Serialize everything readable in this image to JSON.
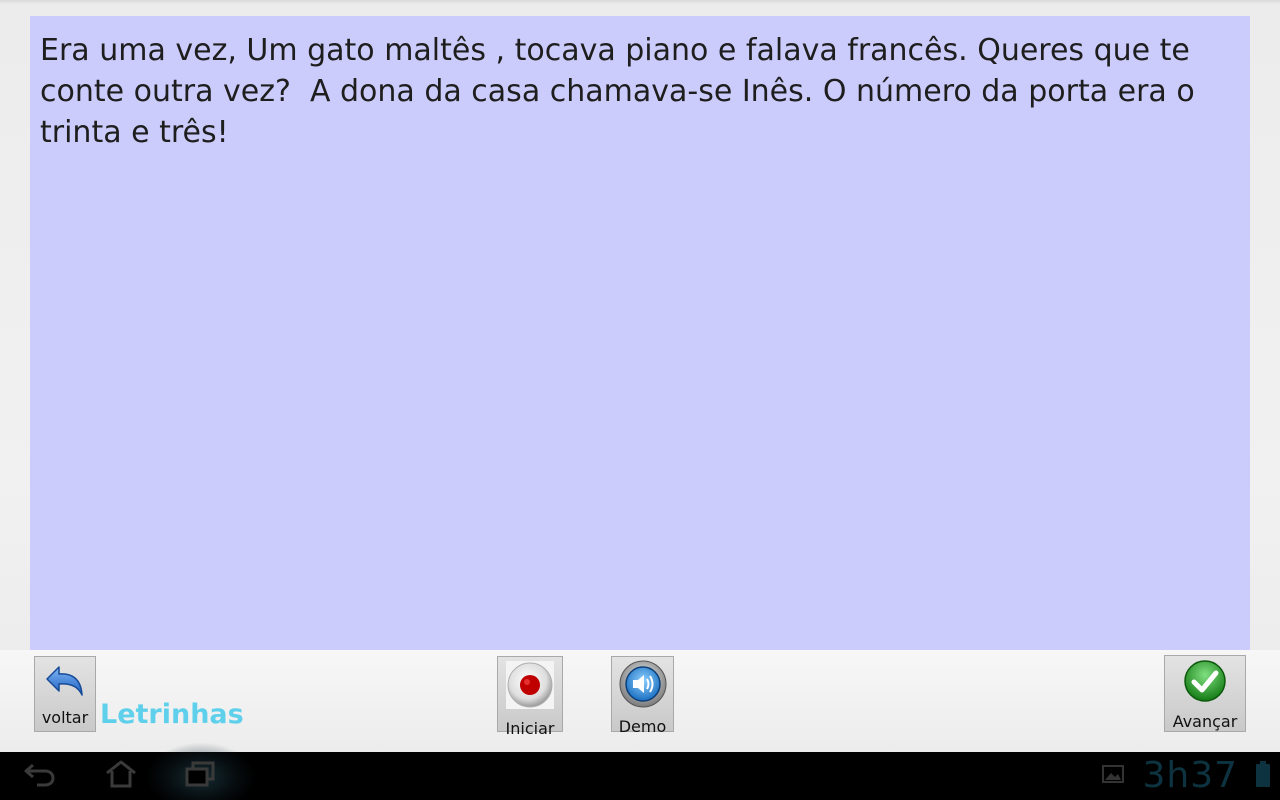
{
  "story": {
    "text": "Era uma vez, Um gato maltês , tocava piano e falava francês. Queres que te conte outra vez?  A dona da casa chamava-se Inês. O número da porta era o trinta e três!"
  },
  "toolbar": {
    "back_label": "voltar",
    "app_name": "Letrinhas",
    "start_label": "Iniciar",
    "demo_label": "Demo",
    "next_label": "Avançar"
  },
  "status_bar": {
    "clock": "3h37"
  },
  "colors": {
    "text_panel_bg": "#ccccfc",
    "app_name": "#5fd0ec",
    "record_dot": "#c00000",
    "check_green": "#2a9a2a"
  },
  "icons": {
    "back": "undo-arrow-icon",
    "start": "record-icon",
    "demo": "speaker-icon",
    "next": "check-icon",
    "nav_back": "nav-back-icon",
    "nav_home": "nav-home-icon",
    "nav_recent": "nav-recent-apps-icon",
    "gallery": "gallery-icon",
    "battery": "battery-icon"
  }
}
